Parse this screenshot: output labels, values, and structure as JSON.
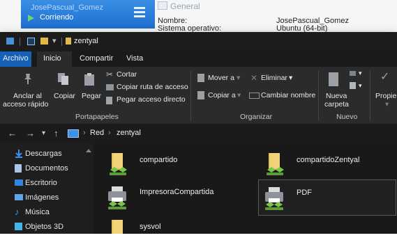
{
  "virtualbox": {
    "vm_name": "JosePascual_Gomez",
    "vm_state": "Corriendo",
    "section_title": "General",
    "details": [
      {
        "key": "Nombre:",
        "value": "JosePascual_Gomez"
      },
      {
        "key": "Sistema operativo:",
        "value": "Ubuntu (64-bit)"
      }
    ]
  },
  "explorer": {
    "window_title": "zentyal",
    "tabs": [
      "Archivo",
      "Inicio",
      "Compartir",
      "Vista"
    ],
    "active_tab": "Inicio",
    "ribbon": {
      "portapapeles": {
        "label": "Portapapeles",
        "anclar": "Anclar al",
        "anclar2": "acceso rápido",
        "copiar": "Copiar",
        "pegar": "Pegar",
        "cortar": "Cortar",
        "copiar_ruta": "Copiar ruta de acceso",
        "pegar_acceso": "Pegar acceso directo"
      },
      "organizar": {
        "label": "Organizar",
        "mover_a": "Mover a",
        "copiar_a": "Copiar a",
        "eliminar": "Eliminar",
        "cambiar_nombre": "Cambiar nombre"
      },
      "nuevo": {
        "label": "Nuevo",
        "nueva": "Nueva",
        "carpeta": "carpeta"
      },
      "abrir": {
        "propiedades": "Propie"
      }
    },
    "address": {
      "path": [
        "Red",
        "zentyal"
      ]
    },
    "navpane": {
      "items": [
        {
          "label": "Descargas",
          "icon": "download-icon",
          "color": "#3b8ff0"
        },
        {
          "label": "Documentos",
          "icon": "document-icon",
          "color": "#7aa7d8"
        },
        {
          "label": "Escritorio",
          "icon": "desktop-icon",
          "color": "#2f86e6"
        },
        {
          "label": "Imágenes",
          "icon": "pictures-icon",
          "color": "#5fa6e8"
        },
        {
          "label": "Música",
          "icon": "music-icon",
          "color": "#3a9bf0"
        },
        {
          "label": "Objetos 3D",
          "icon": "cube-icon",
          "color": "#45b3e8"
        }
      ]
    },
    "content": {
      "items": [
        {
          "label": "compartido",
          "icon": "shared-folder-icon"
        },
        {
          "label": "compartidoZentyal",
          "icon": "shared-folder-icon"
        },
        {
          "label": "ImpresoraCompartida",
          "icon": "shared-printer-icon"
        },
        {
          "label": "PDF",
          "icon": "shared-printer-icon",
          "selected": true
        },
        {
          "label": "sysvol",
          "icon": "shared-folder-icon"
        }
      ]
    }
  }
}
